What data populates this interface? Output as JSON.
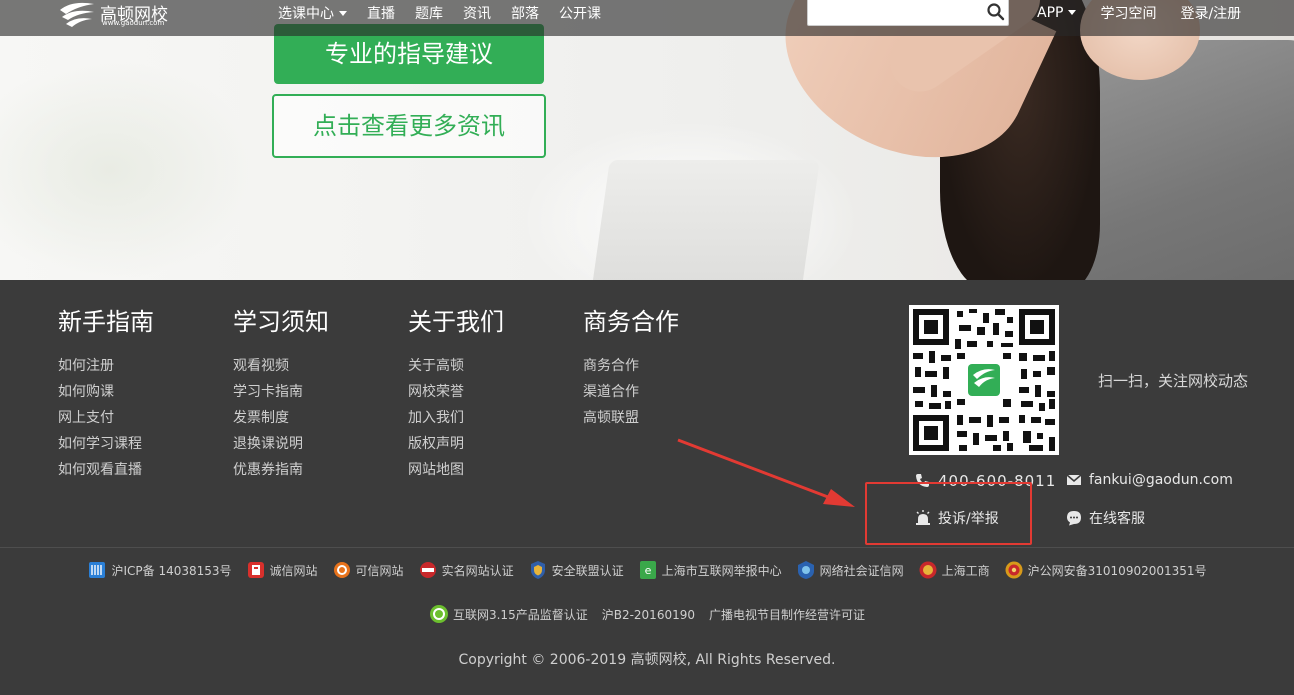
{
  "hero": {
    "advice_button": "专业的指导建议",
    "more_button": "点击查看更多资讯"
  },
  "nav": {
    "logo_name": "高顿网校",
    "logo_url": "www.gaodun.com",
    "items": [
      "选课中心",
      "直播",
      "题库",
      "资讯",
      "部落",
      "公开课"
    ],
    "search_placeholder": "",
    "app": "APP",
    "study_space": "学习空间",
    "login": "登录/注册"
  },
  "footer": {
    "columns": [
      {
        "title": "新手指南",
        "links": [
          "如何注册",
          "如何购课",
          "网上支付",
          "如何学习课程",
          "如何观看直播"
        ]
      },
      {
        "title": "学习须知",
        "links": [
          "观看视频",
          "学习卡指南",
          "发票制度",
          "退换课说明",
          "优惠券指南"
        ]
      },
      {
        "title": "关于我们",
        "links": [
          "关于高顿",
          "网校荣誉",
          "加入我们",
          "版权声明",
          "网站地图"
        ]
      },
      {
        "title": "商务合作",
        "links": [
          "商务合作",
          "渠道合作",
          "高顿联盟"
        ]
      }
    ],
    "qr_text": "扫一扫，关注网校动态",
    "phone": "400-600-8011",
    "email": "fankui@gaodun.com",
    "complaint": "投诉/举报",
    "online_service": "在线客服",
    "certs": [
      {
        "label": "沪ICP备 14038153号",
        "icon": "icp-icon",
        "color": "#2a7fd6"
      },
      {
        "label": "诚信网站",
        "icon": "trust-site-icon",
        "color": "#d9302c"
      },
      {
        "label": "可信网站",
        "icon": "credible-site-icon",
        "color": "#e8731c"
      },
      {
        "label": "实名网站认证",
        "icon": "realname-icon",
        "color": "#c8282b"
      },
      {
        "label": "安全联盟认证",
        "icon": "security-shield-icon",
        "color": "#2f5ea8"
      },
      {
        "label": "上海市互联网举报中心",
        "icon": "report-center-icon",
        "color": "#3aa84a"
      },
      {
        "label": "网络社会证信网",
        "icon": "network-cert-icon",
        "color": "#2a62b0"
      },
      {
        "label": "上海工商",
        "icon": "commerce-badge-icon",
        "color": "#c8282b"
      },
      {
        "label": "沪公网安备31010902001351号",
        "icon": "police-badge-icon",
        "color": "#d79a1a"
      }
    ],
    "cert_row2": [
      {
        "label": "互联网3.15产品监督认证",
        "icon": "315-icon",
        "color": "#6cbf2e"
      },
      {
        "label": "沪B2-20160190",
        "icon": "",
        "color": ""
      },
      {
        "label": "广播电视节目制作经营许可证",
        "icon": "",
        "color": ""
      }
    ],
    "copyright": "Copyright © 2006-2019 高顿网校, All Rights Reserved."
  },
  "colors": {
    "green": "#32ae56",
    "footer_bg": "#3b3b3b",
    "annotation_red": "#e23a33"
  }
}
